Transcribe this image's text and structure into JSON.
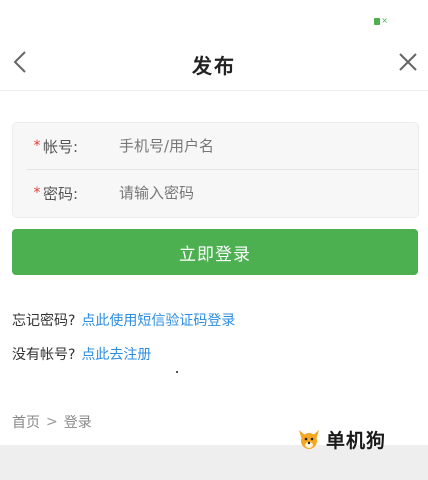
{
  "nav": {
    "title": "发布"
  },
  "form": {
    "account_label": "帐号:",
    "account_placeholder": "手机号/用户名",
    "password_label": "密码:",
    "password_placeholder": "请输入密码",
    "required_mark": "*"
  },
  "login_button_label": "立即登录",
  "help": {
    "forgot_prefix": "忘记密码?",
    "forgot_link": "点此使用短信验证码登录",
    "register_prefix": "没有帐号?",
    "register_link": "点此去注册"
  },
  "breadcrumb": {
    "home": "首页",
    "separator": ">",
    "current": "登录"
  },
  "watermark_text": "单机狗",
  "colors": {
    "accent_green": "#4caf50",
    "link_blue": "#2d8de0",
    "required_red": "#e53935"
  },
  "icons": {
    "back": "chevron-left-icon",
    "close": "close-icon",
    "battery": "battery-icon",
    "watermark": "dog-logo-icon"
  }
}
